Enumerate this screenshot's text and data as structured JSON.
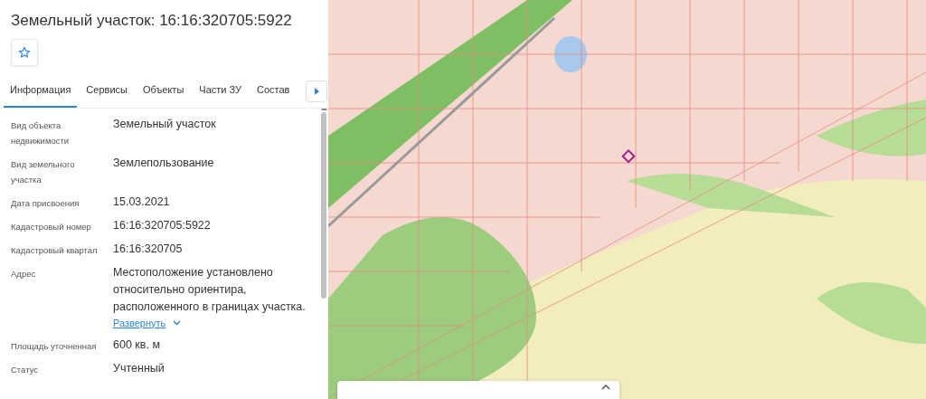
{
  "panel": {
    "title": "Земельный участок: 16:16:320705:5922",
    "tabs": [
      {
        "label": "Информация",
        "selected": true
      },
      {
        "label": "Сервисы",
        "selected": false
      },
      {
        "label": "Объекты",
        "selected": false
      },
      {
        "label": "Части ЗУ",
        "selected": false
      },
      {
        "label": "Состав",
        "selected": false
      }
    ],
    "properties": [
      {
        "label": "Вид объекта недвижимости",
        "value": "Земельный участок"
      },
      {
        "label": "Вид земельного участка",
        "value": "Землепользование"
      },
      {
        "label": "Дата присвоения",
        "value": "15.03.2021"
      },
      {
        "label": "Кадастровый номер",
        "value": "16:16:320705:5922"
      },
      {
        "label": "Кадастровый квартал",
        "value": "16:16:320705"
      },
      {
        "label": "Адрес",
        "value": "Местоположение установлено относительно ориентира, расположенного в границах участка.",
        "expand_link": "Развернуть"
      },
      {
        "label": "Площадь уточненная",
        "value": "600 кв. м"
      },
      {
        "label": "Статус",
        "value": "Учтенный"
      }
    ]
  }
}
